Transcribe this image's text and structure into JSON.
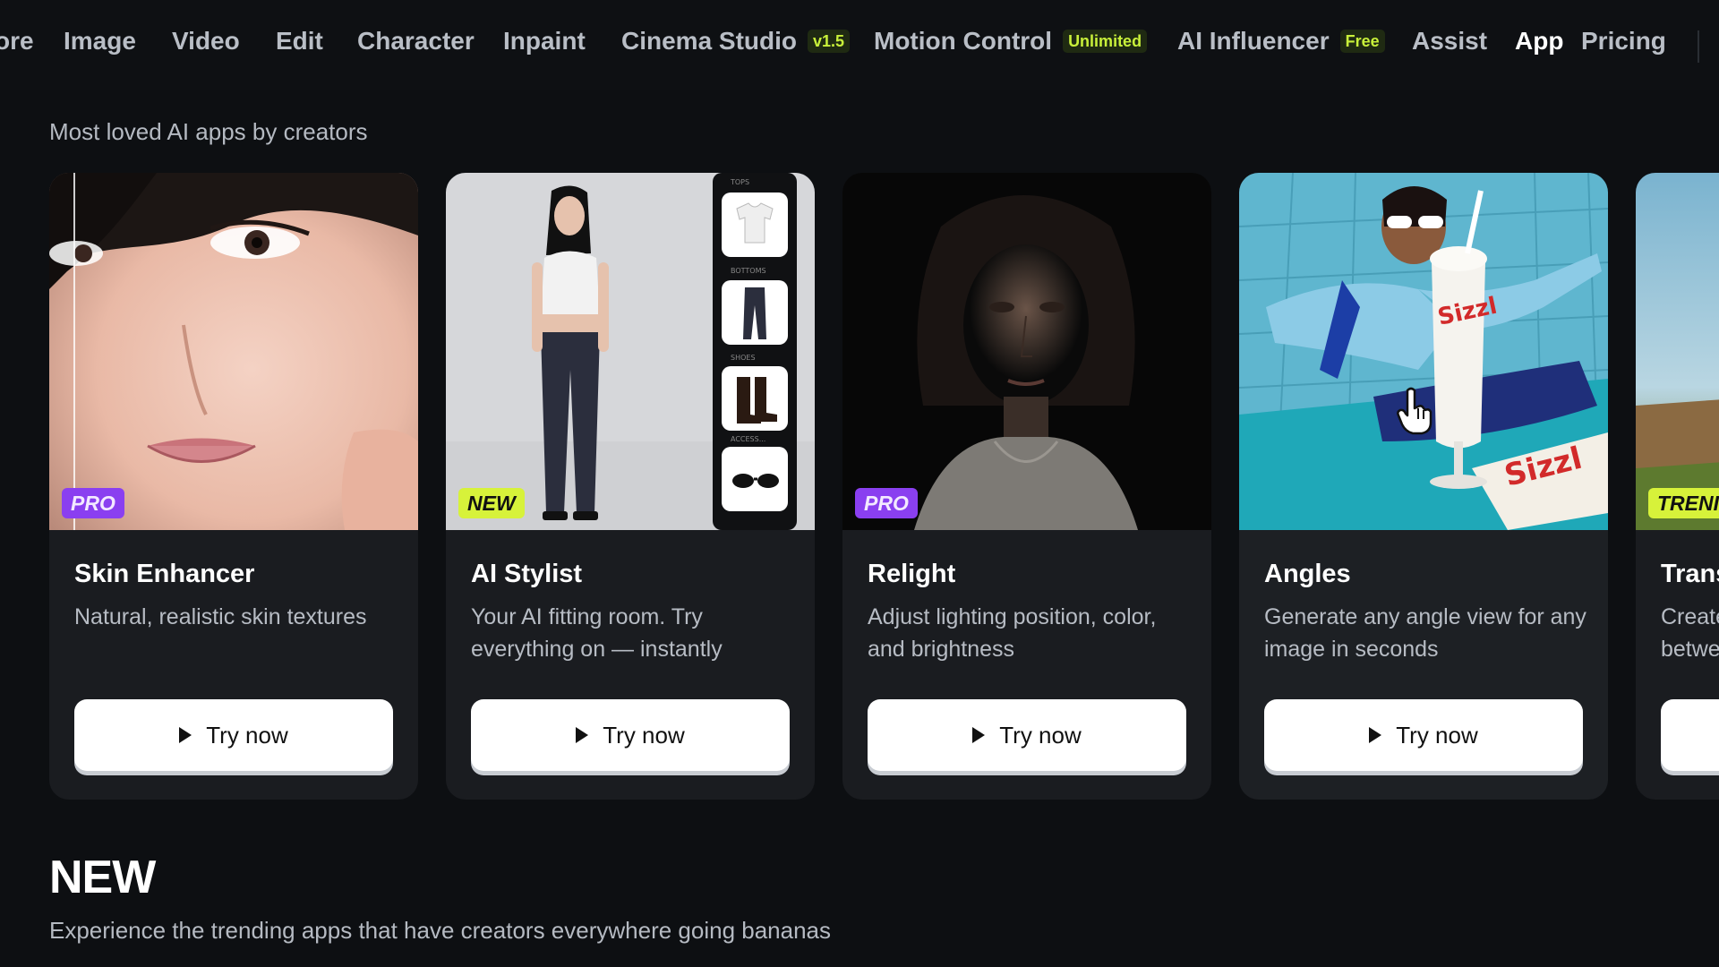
{
  "nav": {
    "items": [
      {
        "label": "ore"
      },
      {
        "label": "Image"
      },
      {
        "label": "Video"
      },
      {
        "label": "Edit"
      },
      {
        "label": "Character"
      },
      {
        "label": "Inpaint"
      },
      {
        "label": "Cinema Studio",
        "badge": "v1.5"
      },
      {
        "label": "Motion Control",
        "badge": "Unlimited"
      },
      {
        "label": "AI Influencer",
        "badge": "Free"
      },
      {
        "label": "Assist"
      },
      {
        "label": "App"
      },
      {
        "label": "Pricing"
      }
    ],
    "active": "App"
  },
  "apps_section": {
    "subtitle": "Most loved AI apps by creators"
  },
  "cards": [
    {
      "title": "Skin Enhancer",
      "description": "Natural, realistic skin textures",
      "tag": "PRO",
      "button": "Try now"
    },
    {
      "title": "AI Stylist",
      "description": "Your AI fitting room. Try everything on — instantly",
      "tag": "NEW",
      "button": "Try now",
      "wardrobe": [
        "TOPS",
        "BOTTOMS",
        "SHOES",
        "ACCESS..."
      ]
    },
    {
      "title": "Relight",
      "description": "Adjust lighting position, color, and brightness",
      "tag": "PRO",
      "button": "Try now"
    },
    {
      "title": "Angles",
      "description": "Generate any angle view for any image in seconds",
      "tag": "",
      "button": "Try now",
      "cup_text": "Sizzl"
    },
    {
      "title": "Trans",
      "description": "Create betwe",
      "tag": "TRENI",
      "button": ""
    }
  ],
  "new_section": {
    "heading": "NEW",
    "subtitle": "Experience the trending apps that have creators everywhere going bananas"
  },
  "colors": {
    "background": "#0d0f12",
    "card": "#1a1c20",
    "pro_tag": "#8a3ff0",
    "new_tag": "#d7f23a",
    "badge_text": "#c8f03a"
  }
}
